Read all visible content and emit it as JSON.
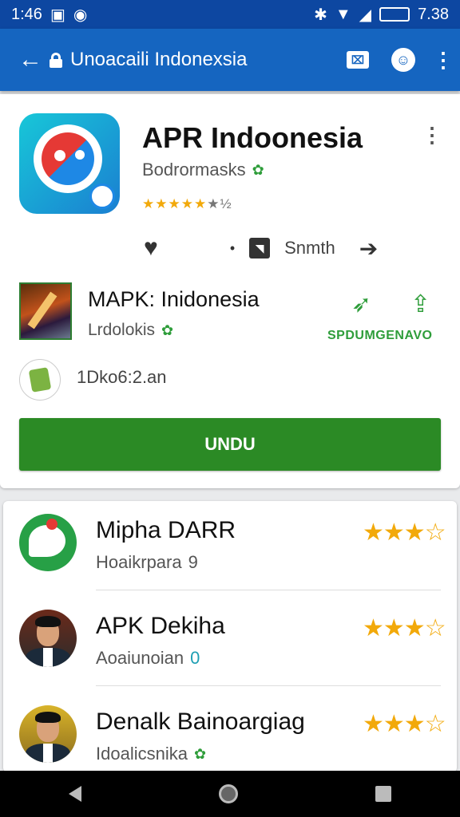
{
  "status_bar": {
    "time_left": "1:46",
    "time_right": "7.38",
    "icons": [
      "image-icon",
      "sync-icon",
      "bluetooth-icon",
      "wifi-icon",
      "signal-icon",
      "battery-icon"
    ]
  },
  "app_bar": {
    "url_title": "Unoacaili Indonexsia",
    "tabs_glyph": "⌧"
  },
  "app": {
    "title": "APR Indoonesia",
    "developer": "Bodrormasks",
    "rating_stars": "★★★★★",
    "rating_tail": "★½",
    "rating_value": 4.5,
    "action_label": "Snmth"
  },
  "sub_app": {
    "title": "MAPK: Inidonesia",
    "developer": "Lrdolokis",
    "tag": "SPDUMGENAVO"
  },
  "size_info": {
    "text": "1Dko6:2.an"
  },
  "download": {
    "label": "UNDU"
  },
  "list": [
    {
      "title": "Mipha DARR",
      "subtitle": "Hoaikrpara",
      "suffix": "9",
      "stars": "★★★",
      "star_empty": "☆",
      "rating": 3.5
    },
    {
      "title": "APK Dekiha",
      "subtitle": "Aoaiunoian",
      "suffix": "0",
      "stars": "★★★",
      "star_empty": "☆",
      "rating": 3.5
    },
    {
      "title": "Denalk Bainoargiag",
      "subtitle": "Idoalicsnika",
      "suffix": "✿",
      "stars": "★★★",
      "star_empty": "☆",
      "rating": 3.5
    }
  ],
  "colors": {
    "status_bar": "#0d47a1",
    "app_bar": "#1565c0",
    "accent_green": "#2b8a25",
    "star": "#f2a90a"
  }
}
